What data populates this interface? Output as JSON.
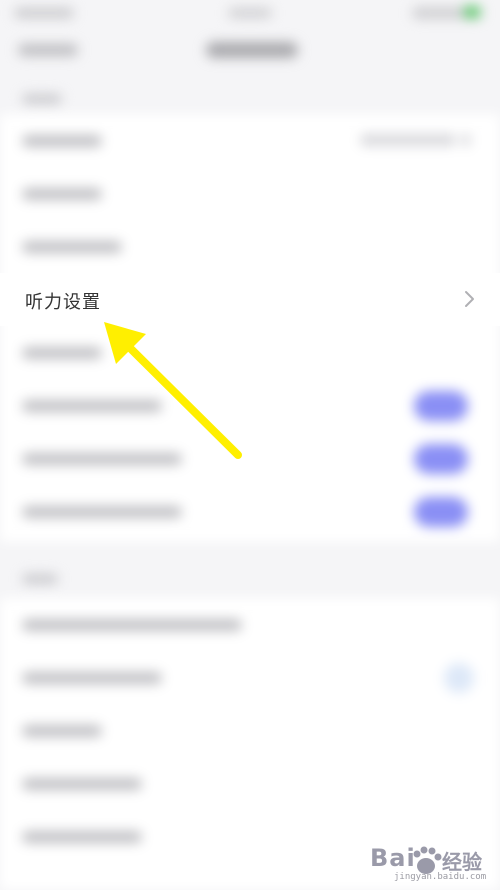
{
  "settings": {
    "focused_item_label": "听力设置"
  },
  "watermark": {
    "brand": "Bai",
    "brand_cn": "经验",
    "url": "jingyan.baidu.com"
  },
  "colors": {
    "accent_toggle": "#8a8ff5",
    "annotation_arrow": "#ffef00",
    "status_battery": "#5cc86a"
  },
  "icons": {
    "row_chevron": "chevron-right-icon",
    "annotation": "arrow-annotation-icon"
  }
}
